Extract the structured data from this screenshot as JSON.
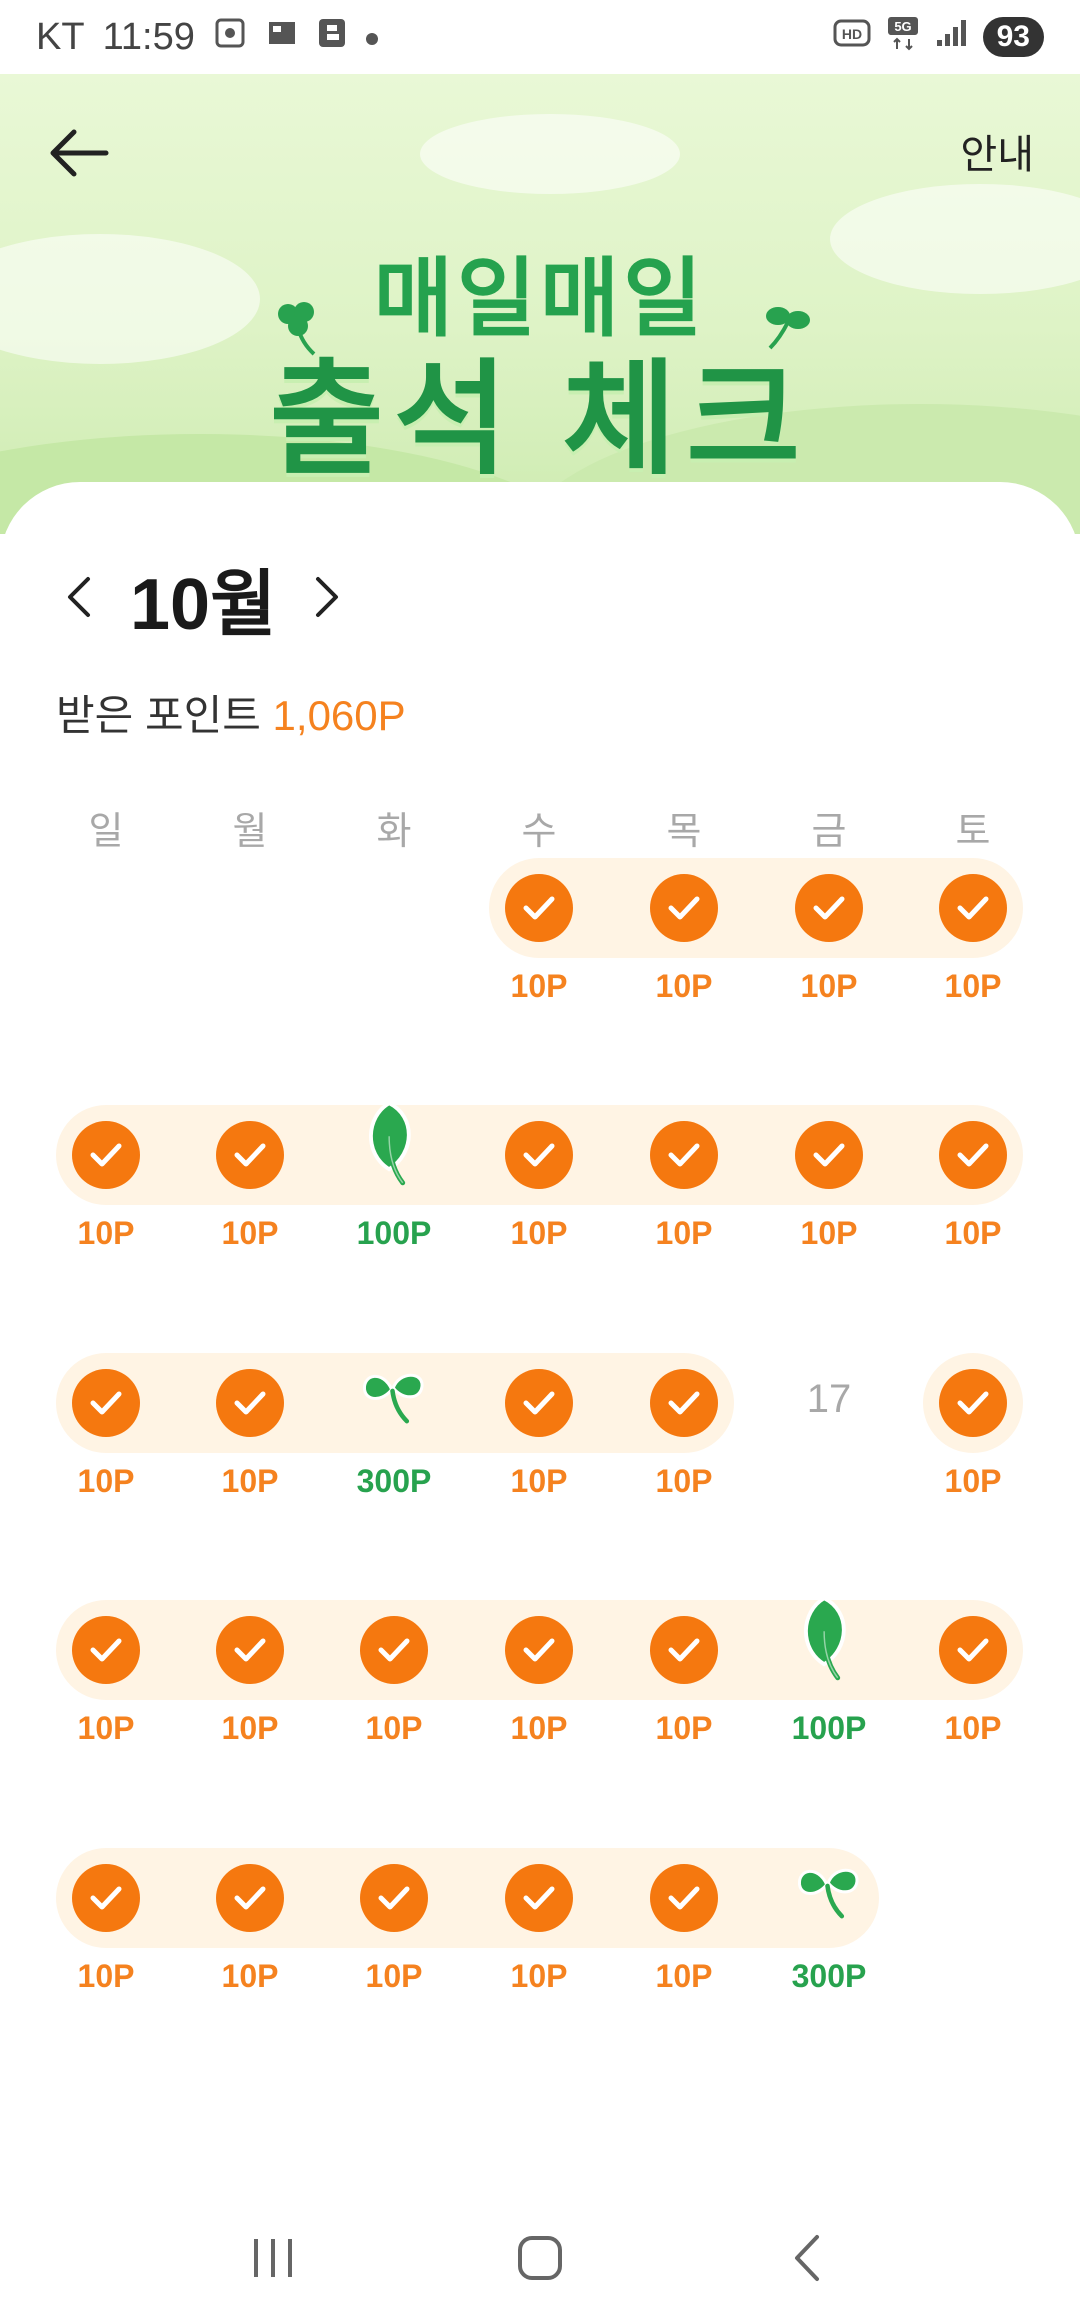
{
  "status_bar": {
    "carrier": "KT",
    "time": "11:59",
    "battery": "93"
  },
  "header": {
    "guide_label": "안내",
    "title_line1": "매일매일",
    "title_line2": "출석 체크"
  },
  "calendar": {
    "month": "10월",
    "points_label": "받은 포인트",
    "points_value": "1,060P",
    "weekdays": [
      "일",
      "월",
      "화",
      "수",
      "목",
      "금",
      "토"
    ],
    "weeks": [
      [
        null,
        null,
        null,
        {
          "type": "check",
          "points": "10P"
        },
        {
          "type": "check",
          "points": "10P"
        },
        {
          "type": "check",
          "points": "10P"
        },
        {
          "type": "check",
          "points": "10P"
        }
      ],
      [
        {
          "type": "check",
          "points": "10P"
        },
        {
          "type": "check",
          "points": "10P"
        },
        {
          "type": "leaf",
          "points": "100P"
        },
        {
          "type": "check",
          "points": "10P"
        },
        {
          "type": "check",
          "points": "10P"
        },
        {
          "type": "check",
          "points": "10P"
        },
        {
          "type": "check",
          "points": "10P"
        }
      ],
      [
        {
          "type": "check",
          "points": "10P"
        },
        {
          "type": "check",
          "points": "10P"
        },
        {
          "type": "sprout",
          "points": "300P"
        },
        {
          "type": "check",
          "points": "10P"
        },
        {
          "type": "check",
          "points": "10P"
        },
        {
          "type": "empty",
          "date": "17"
        },
        {
          "type": "check",
          "points": "10P"
        }
      ],
      [
        {
          "type": "check",
          "points": "10P"
        },
        {
          "type": "check",
          "points": "10P"
        },
        {
          "type": "check",
          "points": "10P"
        },
        {
          "type": "check",
          "points": "10P"
        },
        {
          "type": "check",
          "points": "10P"
        },
        {
          "type": "leaf",
          "points": "100P"
        },
        {
          "type": "check",
          "points": "10P"
        }
      ],
      [
        {
          "type": "check",
          "points": "10P"
        },
        {
          "type": "check",
          "points": "10P"
        },
        {
          "type": "check",
          "points": "10P"
        },
        {
          "type": "check",
          "points": "10P"
        },
        {
          "type": "check",
          "points": "10P"
        },
        {
          "type": "sprout",
          "points": "300P"
        },
        null
      ]
    ]
  },
  "colors": {
    "accent_orange": "#f5780f",
    "points_orange": "#f5821f",
    "bonus_green": "#27a24e",
    "band_bg": "#fff4e4",
    "hero_bg": "#e3f5cd"
  },
  "icons": {
    "back": "arrow-left-icon",
    "prev_month": "chevron-left-icon",
    "next_month": "chevron-right-icon",
    "check": "check-icon",
    "leaf": "leaf-icon",
    "sprout": "sprout-icon"
  }
}
